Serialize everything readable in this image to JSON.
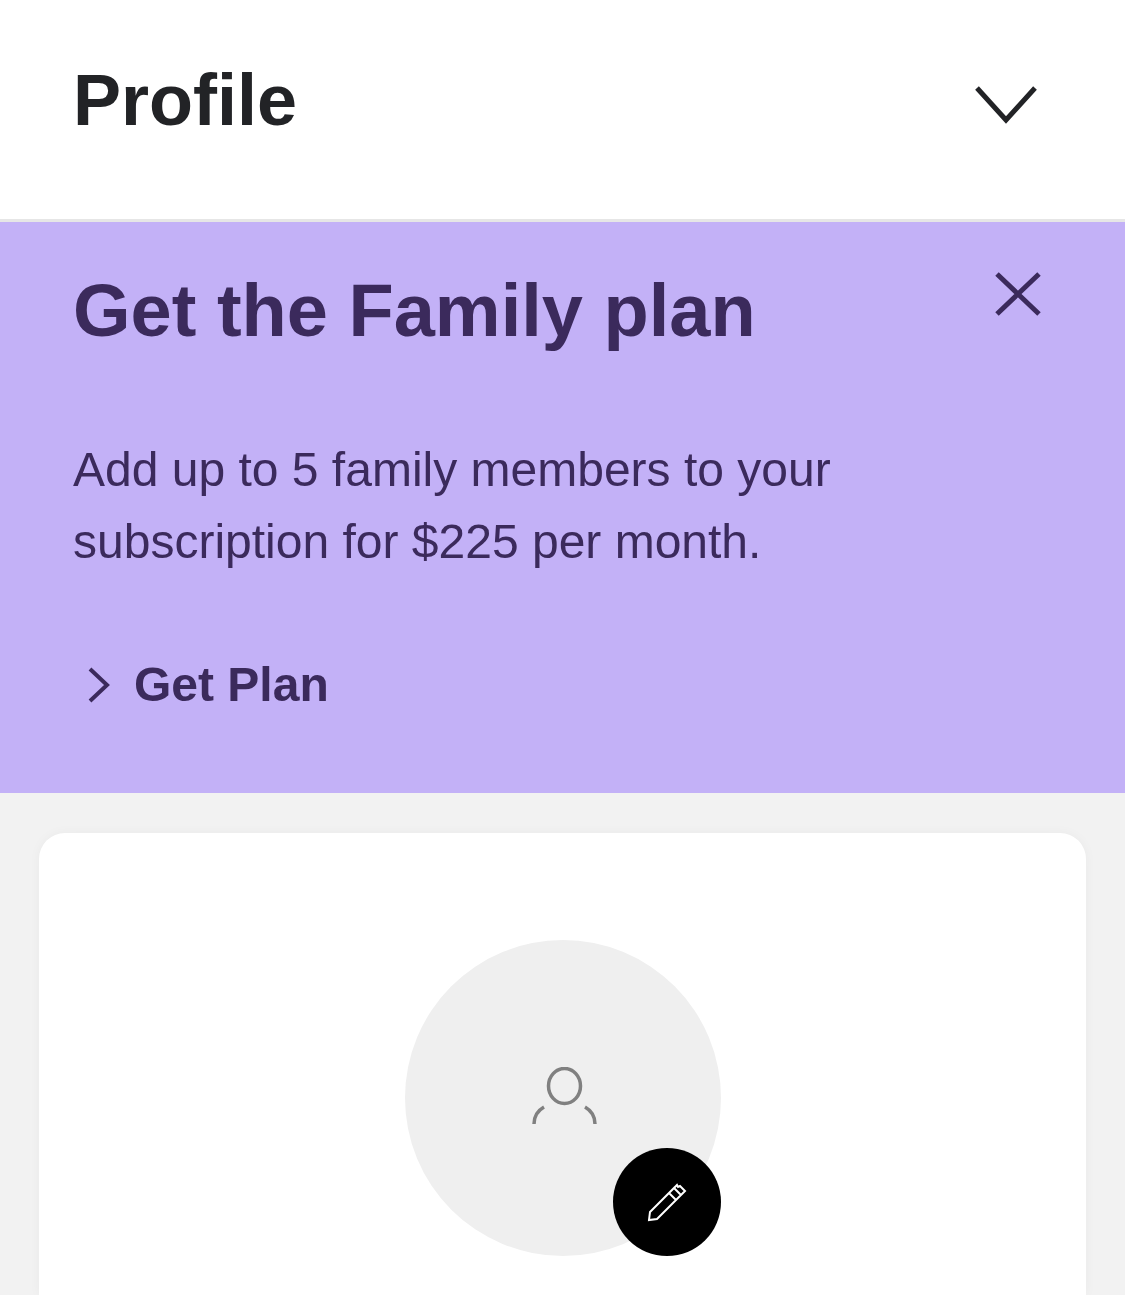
{
  "header": {
    "title": "Profile"
  },
  "banner": {
    "title": "Get the Family plan",
    "text": "Add up to 5 family members to your subscription for $225 per month.",
    "link": "Get Plan"
  }
}
